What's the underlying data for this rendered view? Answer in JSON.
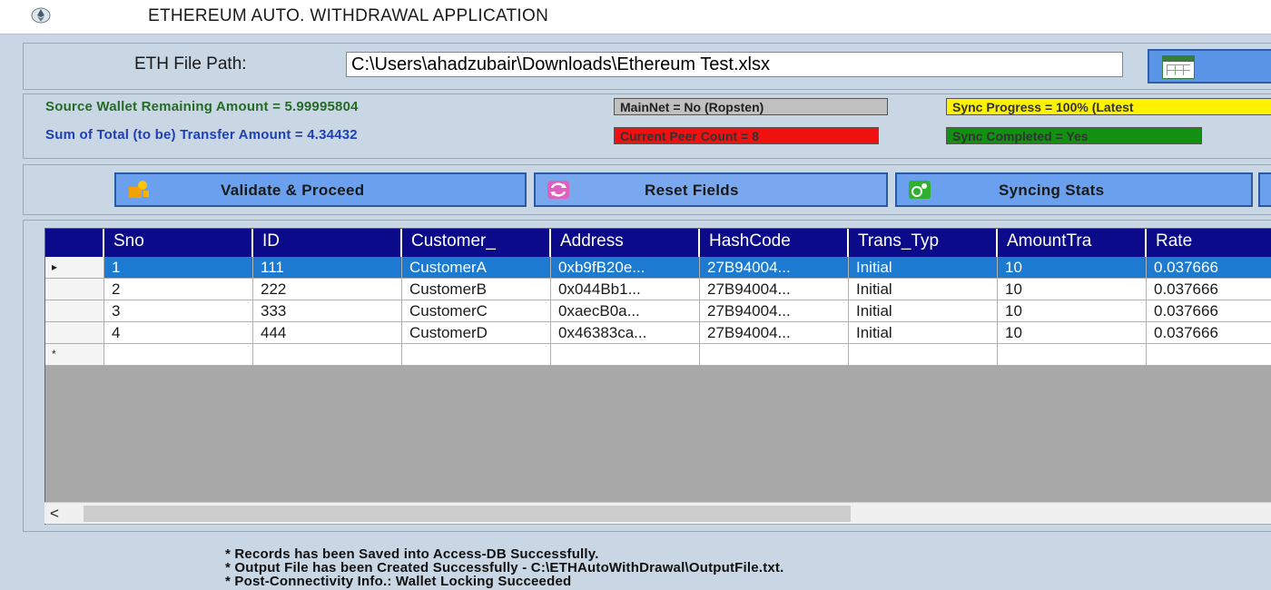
{
  "window": {
    "title": "ETHEREUM AUTO. WITHDRAWAL APPLICATION"
  },
  "file": {
    "label": "ETH File Path:",
    "path": "C:\\Users\\ahadzubair\\Downloads\\Ethereum Test.xlsx",
    "browse_label": ""
  },
  "stats": {
    "remaining": "Source Wallet Remaining Amount = 5.99995804",
    "sum_total": "Sum of Total (to be) Transfer Amount = 4.34432",
    "mainnet": "MainNet = No (Ropsten)",
    "peer_count": "Current Peer Count = 8",
    "sync_progress": "Sync Progress = 100% (Latest",
    "sync_completed": "Sync Completed = Yes"
  },
  "colors": {
    "mainnet": "#c0c0c0",
    "peer": "#f01010",
    "sync_progress": "#fff200",
    "sync_completed": "#119011",
    "header": "#0a0a8a",
    "selection": "#1c7ad0"
  },
  "buttons": {
    "validate": "Validate & Proceed",
    "reset": "Reset Fields",
    "syncing": "Syncing Stats"
  },
  "grid": {
    "columns": [
      "Sno",
      "ID",
      "Customer_",
      "Address",
      "HashCode",
      "Trans_Typ",
      "AmountTra",
      "Rate"
    ],
    "rows": [
      {
        "marker": "▸",
        "cells": [
          "1",
          "111",
          "CustomerA",
          "0xb9fB20e...",
          "27B94004...",
          "Initial",
          "10",
          "0.037666"
        ]
      },
      {
        "marker": "",
        "cells": [
          "2",
          "222",
          "CustomerB",
          "0x044Bb1...",
          "27B94004...",
          "Initial",
          "10",
          "0.037666"
        ]
      },
      {
        "marker": "",
        "cells": [
          "3",
          "333",
          "CustomerC",
          "0xaecB0a...",
          "27B94004...",
          "Initial",
          "10",
          "0.037666"
        ]
      },
      {
        "marker": "",
        "cells": [
          "4",
          "444",
          "CustomerD",
          "0x46383ca...",
          "27B94004...",
          "Initial",
          "10",
          "0.037666"
        ]
      },
      {
        "marker": "*",
        "cells": [
          "",
          "",
          "",
          "",
          "",
          "",
          "",
          ""
        ]
      }
    ],
    "scroll_left": "<"
  },
  "log": [
    "* Records has been Saved into Access-DB Successfully.",
    "* Output File has been Created Successfully - C:\\ETHAutoWithDrawal\\OutputFile.txt.",
    "* Post-Connectivity Info.: Wallet Locking Succeeded"
  ]
}
